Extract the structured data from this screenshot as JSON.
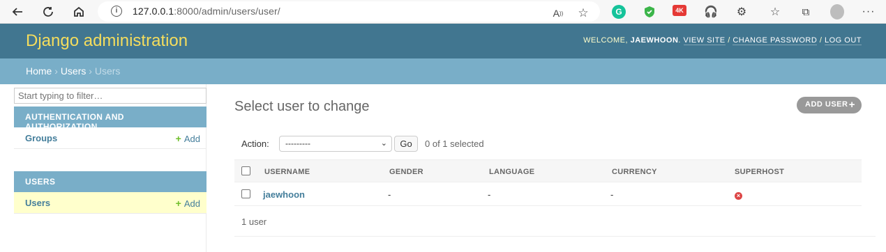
{
  "browser": {
    "url_host": "127.0.0.1",
    "url_rest": ":8000/admin/users/user/"
  },
  "header": {
    "branding": "Django administration",
    "welcome": "Welcome,",
    "username": "jaewhoon",
    "view_site": "View site",
    "change_password": "Change password",
    "log_out": "Log out"
  },
  "breadcrumbs": {
    "home": "Home",
    "app": "Users",
    "current": "Users"
  },
  "sidebar": {
    "filter_placeholder": "Start typing to filter…",
    "apps": [
      {
        "caption": "Authentication and Authorization",
        "models": [
          {
            "name": "Groups",
            "add": "Add"
          }
        ]
      },
      {
        "caption": "Users",
        "models": [
          {
            "name": "Users",
            "add": "Add"
          }
        ]
      }
    ]
  },
  "main": {
    "title": "Select user to change",
    "add_button": "Add user",
    "action_label": "Action:",
    "action_selected": "---------",
    "go_label": "Go",
    "selection_counter": "0 of 1 selected",
    "columns": [
      "Username",
      "Gender",
      "Language",
      "Currency",
      "Superhost"
    ],
    "rows": [
      {
        "username": "jaewhoon",
        "gender": "-",
        "language": "-",
        "currency": "-",
        "superhost": false
      }
    ],
    "paginator": "1 user"
  }
}
